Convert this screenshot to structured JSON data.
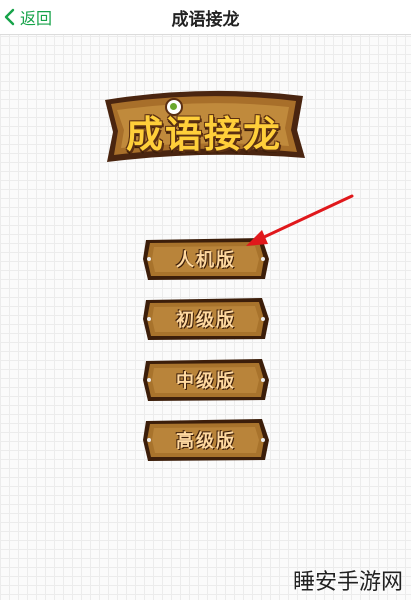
{
  "nav": {
    "back_label": "返回",
    "title": "成语接龙"
  },
  "logo": {
    "text": "成语接龙"
  },
  "menu": {
    "items": [
      {
        "label": "人机版"
      },
      {
        "label": "初级版"
      },
      {
        "label": "中级版"
      },
      {
        "label": "高级版"
      }
    ]
  },
  "watermark": "睡安手游网",
  "colors": {
    "nav_accent": "#17a34a",
    "wood": "#b07a2e",
    "wood_dark": "#4a2510",
    "logo_text": "#ffcf3a",
    "arrow": "#e0181c"
  }
}
